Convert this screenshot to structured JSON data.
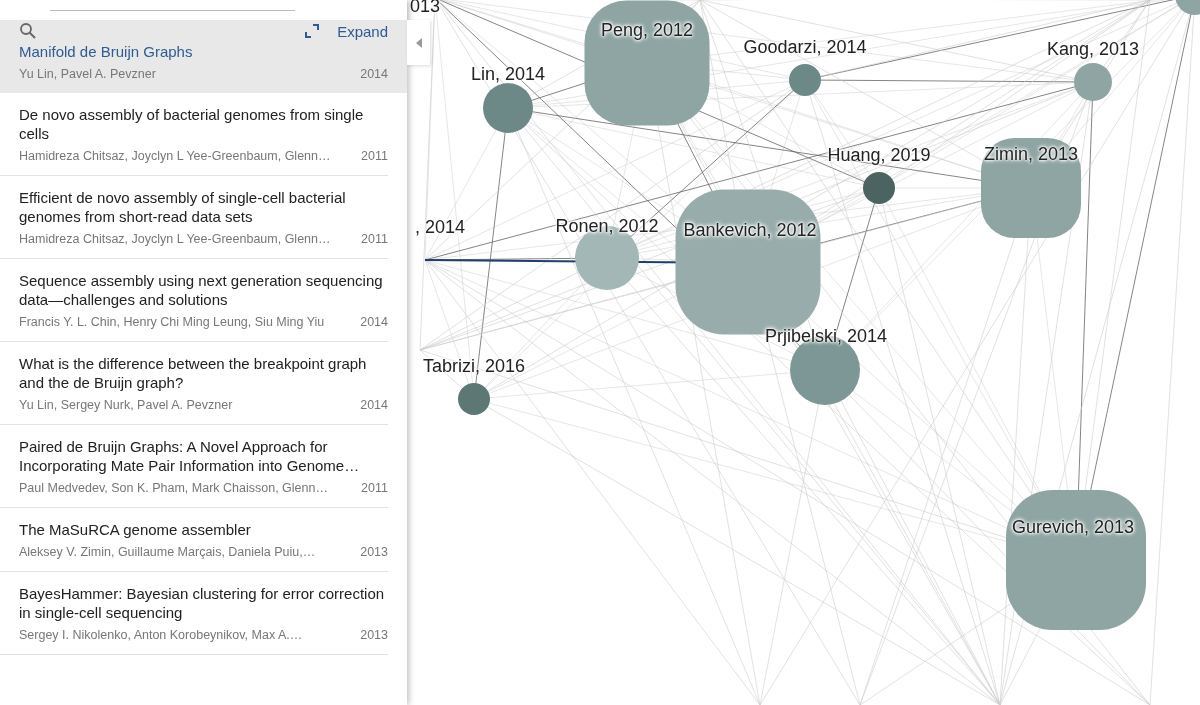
{
  "panel": {
    "expand_label": "Expand",
    "papers": [
      {
        "title": "Manifold de Bruijn Graphs",
        "authors": "Yu Lin, Pavel A. Pevzner",
        "year": "2014",
        "selected": true
      },
      {
        "title": "De novo assembly of bacterial genomes from single cells",
        "authors": "Hamidreza Chitsaz, Joyclyn L Yee-Greenbaum, Glenn…",
        "year": "2011",
        "selected": false
      },
      {
        "title": "Efficient de novo assembly of single-cell bacterial genomes from short-read data sets",
        "authors": "Hamidreza Chitsaz, Joyclyn L Yee-Greenbaum, Glenn…",
        "year": "2011",
        "selected": false
      },
      {
        "title": "Sequence assembly using next generation sequencing data—challenges and solutions",
        "authors": "Francis Y. L. Chin, Henry Chi Ming Leung, Siu Ming Yiu",
        "year": "2014",
        "selected": false
      },
      {
        "title": "What is the difference between the breakpoint graph and the de Bruijn graph?",
        "authors": "Yu Lin, Sergey Nurk, Pavel A. Pevzner",
        "year": "2014",
        "selected": false
      },
      {
        "title": "Paired de Bruijn Graphs: A Novel Approach for Incorporating Mate Pair Information into Genome…",
        "authors": "Paul Medvedev, Son K. Pham, Mark Chaisson, Glenn…",
        "year": "2011",
        "selected": false
      },
      {
        "title": "The MaSuRCA genome assembler",
        "authors": "Aleksey V. Zimin, Guillaume Marçais, Daniela Puiu,…",
        "year": "2013",
        "selected": false
      },
      {
        "title": "BayesHammer: Bayesian clustering for error correction in single-cell sequencing",
        "authors": "Sergey I. Nikolenko, Anton Korobeynikov, Max A.…",
        "year": "2013",
        "selected": false
      }
    ]
  },
  "graph": {
    "nodes": [
      {
        "label": "013"
      },
      {
        "label": "Peng, 2012",
        "color": "#8ea5a3"
      },
      {
        "label": "Goodarzi, 2014",
        "color": "#6d8987"
      },
      {
        "label": "Kang, 2013",
        "color": "#8ea5a3"
      },
      {
        "label": "Lin, 2014",
        "color": "#6d8987"
      },
      {
        "label": "Huang, 2019",
        "color": "#4b6361"
      },
      {
        "label": "Zimin, 2013",
        "color": "#8ea5a3"
      },
      {
        "label": ", 2014"
      },
      {
        "label": "Ronen, 2012",
        "color": "#a3b8b6"
      },
      {
        "label": "Bankevich, 2012",
        "color": "#98adab"
      },
      {
        "label": "Prjibelski, 2014",
        "color": "#7c9795"
      },
      {
        "label": "Tabrizi, 2016",
        "color": "#5d7775"
      },
      {
        "label": "Gurevich, 2013",
        "color": "#8ea5a3"
      },
      {
        "color": "#8ea5a3"
      }
    ]
  }
}
